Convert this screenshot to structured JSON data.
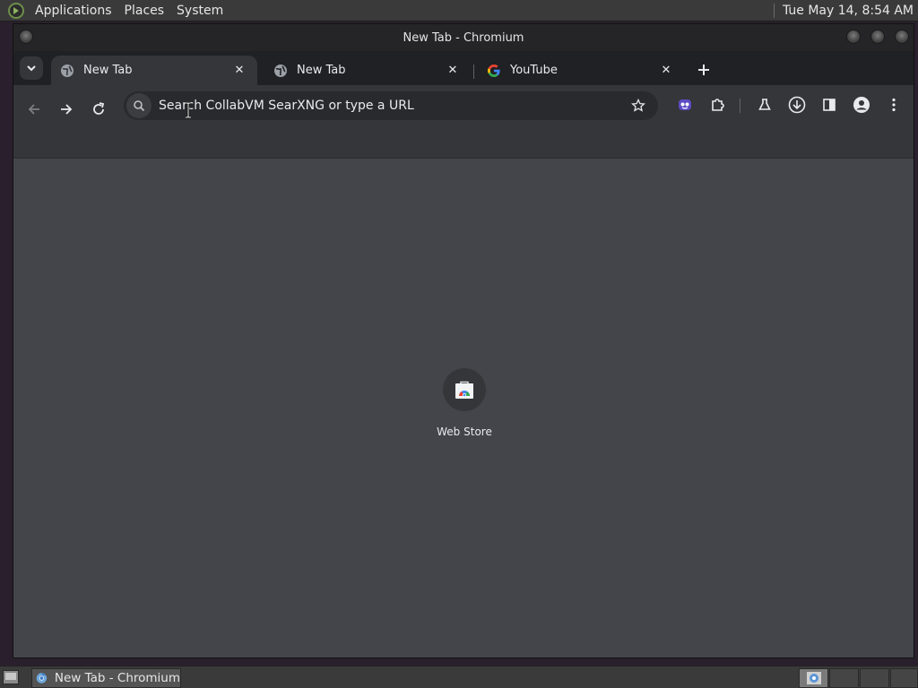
{
  "panel": {
    "menus": [
      "Applications",
      "Places",
      "System"
    ],
    "clock": "Tue May 14,  8:54 AM"
  },
  "window": {
    "title": "New Tab - Chromium"
  },
  "tabs": [
    {
      "title": "New Tab",
      "icon": "globe-icon",
      "active": true
    },
    {
      "title": "New Tab",
      "icon": "globe-icon",
      "active": false
    },
    {
      "title": "YouTube",
      "icon": "google-icon",
      "active": false
    }
  ],
  "omnibox": {
    "placeholder": "Search CollabVM SearXNG or type a URL"
  },
  "toolbar": {
    "icons": [
      "back-icon",
      "forward-icon",
      "reload-icon",
      "bookmark-star-icon",
      "extension-mascot-icon",
      "extensions-puzzle-icon",
      "labs-flask-icon",
      "downloads-icon",
      "side-panel-icon",
      "profile-icon",
      "menu-kebab-icon"
    ]
  },
  "content": {
    "shortcuts": [
      {
        "label": "Web Store",
        "icon": "web-store-icon"
      }
    ]
  },
  "taskbar": {
    "tasks": [
      {
        "label": "New Tab - Chromium",
        "icon": "chromium-icon"
      }
    ]
  },
  "colors": {
    "tab_strip": "#202124",
    "toolbar": "#35363a",
    "omnibox": "#282a2d",
    "page_background": "#44444b",
    "text": "#e8eaed"
  }
}
